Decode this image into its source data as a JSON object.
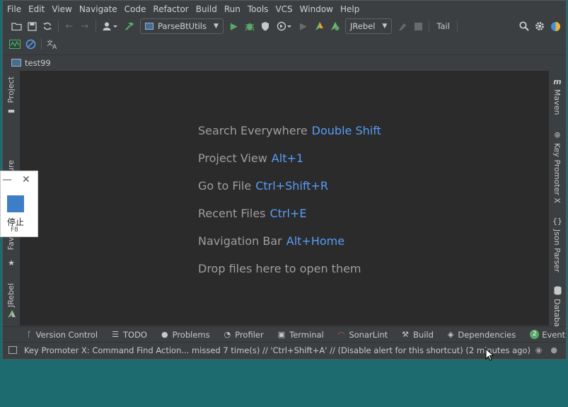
{
  "menu": [
    "File",
    "Edit",
    "View",
    "Navigate",
    "Code",
    "Refactor",
    "Build",
    "Run",
    "Tools",
    "VCS",
    "Window",
    "Help"
  ],
  "toolbar": {
    "run_config": "ParseBtUtils",
    "jrebel_combo": "JRebel",
    "tail_label": "Tail"
  },
  "tab": {
    "label": "test99"
  },
  "editor_hints": [
    {
      "label": "Search Everywhere",
      "key": "Double Shift"
    },
    {
      "label": "Project View",
      "key": "Alt+1"
    },
    {
      "label": "Go to File",
      "key": "Ctrl+Shift+R"
    },
    {
      "label": "Recent Files",
      "key": "Ctrl+E"
    },
    {
      "label": "Navigation Bar",
      "key": "Alt+Home"
    },
    {
      "label": "Drop files here to open them",
      "key": ""
    }
  ],
  "left_tabs": {
    "project": "Project",
    "structure_partial": "ure",
    "favorites_partial": "Favo",
    "jrebel": "JRebel"
  },
  "right_tabs": {
    "maven": "Maven",
    "key_promoter": "Key Promoter X",
    "json_parser": "Json Parser",
    "database_partial": "Databa"
  },
  "bottom_tabs": [
    {
      "label": "Version Control",
      "icon": "branch-icon"
    },
    {
      "label": "TODO",
      "icon": "list-icon"
    },
    {
      "label": "Problems",
      "icon": "warning-icon"
    },
    {
      "label": "Profiler",
      "icon": "profiler-icon"
    },
    {
      "label": "Terminal",
      "icon": "terminal-icon"
    },
    {
      "label": "SonarLint",
      "icon": "sonarlint-icon"
    },
    {
      "label": "Build",
      "icon": "hammer-icon"
    },
    {
      "label": "Dependencies",
      "icon": "layers-icon"
    },
    {
      "label": "Event Lo",
      "icon": "event-log-icon",
      "badge": "2"
    }
  ],
  "status": {
    "message": "Key Promoter X: Command Find Action... missed 7 time(s) // 'Ctrl+Shift+A' // (Disable alert for this shortcut) (2 minutes ago)"
  },
  "overlay": {
    "stop_label": "停止",
    "stop_key": "F8"
  },
  "colors": {
    "accent_key": "#589df6",
    "editor_bg": "#2b2b2b",
    "chrome_bg": "#3c3f41",
    "desktop_bg": "#1d6a6f"
  }
}
